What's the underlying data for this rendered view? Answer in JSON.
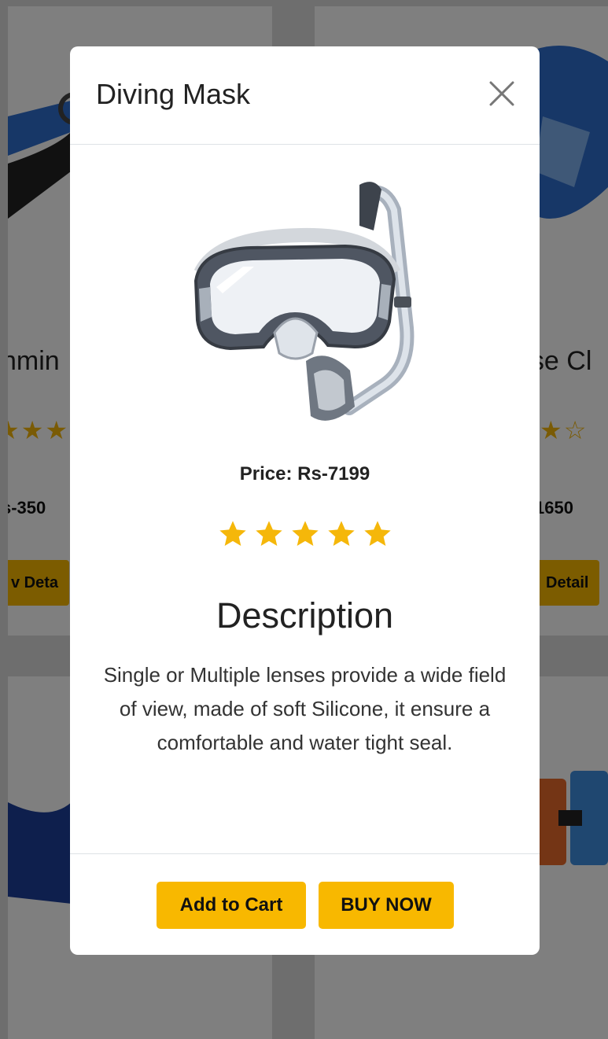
{
  "background": {
    "left_card": {
      "title_fragment": "nmin",
      "price_fragment": "s-350",
      "button_fragment": "v Deta"
    },
    "right_card": {
      "title_fragment": "ose Cl",
      "price_fragment": "1650",
      "button_fragment": "Detail"
    }
  },
  "modal": {
    "title": "Diving Mask",
    "close_icon": "close-icon",
    "price": "Price: Rs-7199",
    "rating": 5,
    "star_color": "#f5b70a",
    "description_heading": "Description",
    "description": "Single or Multiple lenses provide a wide field of view, made of soft Silicone, it ensure a comfortable and water tight seal.",
    "buttons": {
      "add_to_cart": "Add to Cart",
      "buy_now": "BUY NOW"
    },
    "accent_color": "#f8b800"
  }
}
